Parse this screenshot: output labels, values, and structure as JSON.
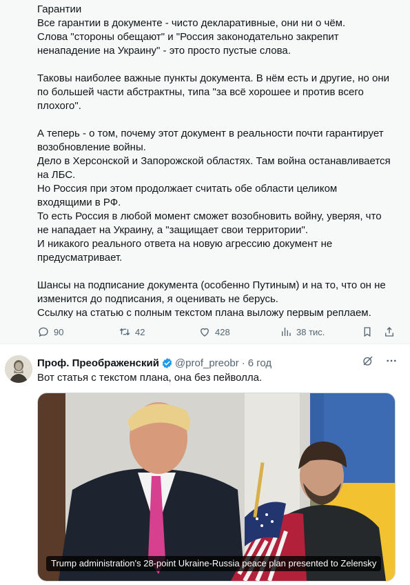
{
  "tweet1": {
    "text": "Гарантии\nВсе гарантии в документе - чисто декларативные, они ни о чём.\nСлова \"стороны обещают\" и \"Россия законодательно закрепит\nненападение на Украину\" - это просто пустые слова.\n\nТаковы наиболее важные пункты документа. В нём есть и другие, но они\nпо большей части абстрактны, типа \"за всё хорошее и против всего\nплохого\".\n\nА теперь - о том, почему этот документ в реальности почти гарантирует\nвозобновление войны.\nДело в Херсонской и Запорожской областях. Там война останавливается\nна ЛБС.\nНо Россия при этом продолжает считать обе области целиком\nвходящими в РФ.\nТо есть Россия в любой момент сможет возобновить войну, уверяя, что\nне нападает на Украину, а \"защищает свои территории\".\nИ никакого реального ответа на новую агрессию документ не\nпредусматривает.\n\nШансы на подписание документа (особенно Путиным) и на то, что он не\nизменится до подписания, я оценивать не берусь.\nСсылку на статью с полным текстом плана выложу первым реплаем.",
    "actions": {
      "replies": "90",
      "reposts": "42",
      "likes": "428",
      "views": "38 тис."
    }
  },
  "tweet2": {
    "author_name": "Проф. Преображенский",
    "handle": "@prof_preobr",
    "separator": "·",
    "time": "6 год",
    "text": "Вот статья с текстом плана, она без пейволла.",
    "media_caption": "Trump administration's 28-point Ukraine-Russia peace plan presented to Zelensky"
  },
  "colors": {
    "accent": "#1d9bf0",
    "muted": "#536471",
    "text": "#0f1419"
  },
  "icons": [
    "reply-icon",
    "repost-icon",
    "like-icon",
    "views-icon",
    "verified-icon",
    "grok-icon",
    "more-icon"
  ]
}
